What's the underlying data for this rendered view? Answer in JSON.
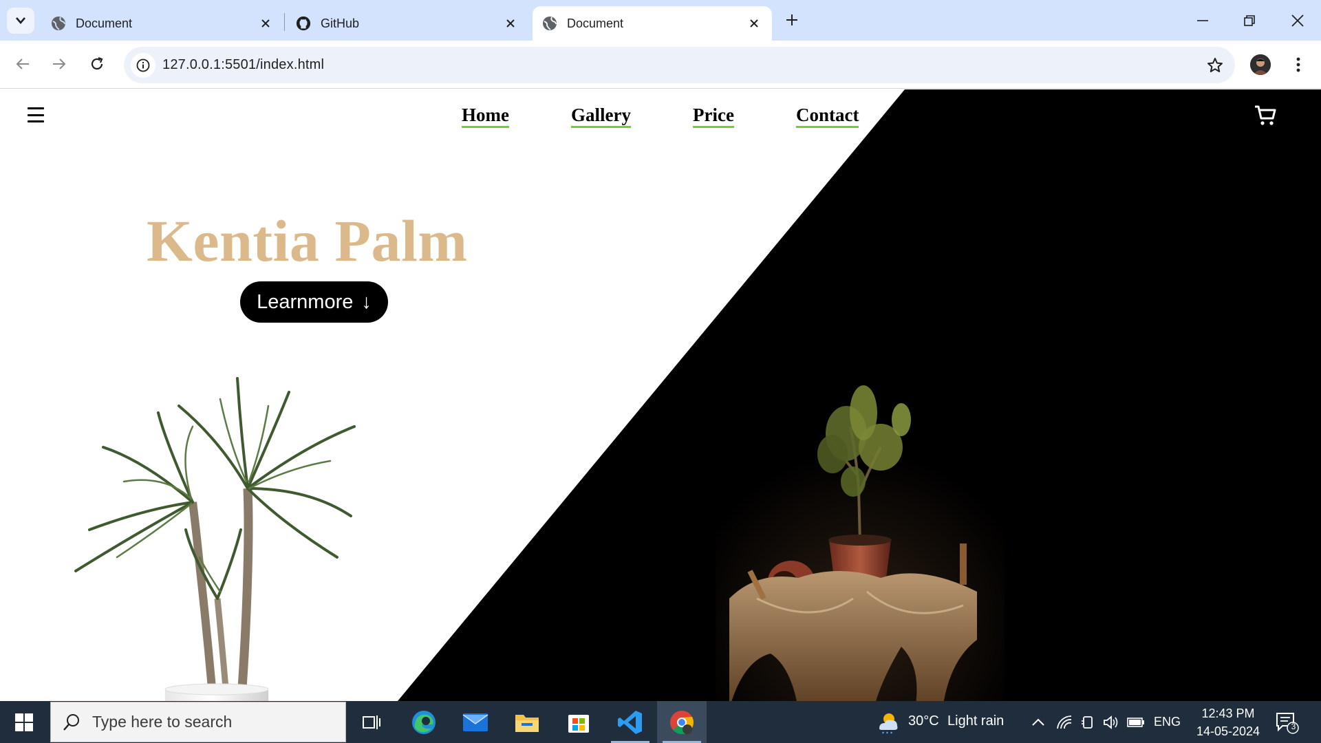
{
  "browser": {
    "tabs": [
      {
        "title": "Document",
        "icon": "globe-icon",
        "active": false
      },
      {
        "title": "GitHub",
        "icon": "github-icon",
        "active": false
      },
      {
        "title": "Document",
        "icon": "globe-icon",
        "active": true
      }
    ],
    "url": "127.0.0.1:5501/index.html"
  },
  "page": {
    "nav": {
      "home": "Home",
      "gallery": "Gallery",
      "price": "Price",
      "contact": "Contact"
    },
    "hero_title": "Kentia Palm",
    "cta_label": "Learnmore",
    "cta_icon": "↓",
    "colors": {
      "title": "#dcb98a",
      "nav_underline": "#6ed12c",
      "dark_panel": "#000000"
    }
  },
  "taskbar": {
    "search_placeholder": "Type here to search",
    "weather_temp": "30°C",
    "weather_desc": "Light rain",
    "language": "ENG",
    "time": "12:43 PM",
    "date": "14-05-2024",
    "notification_count": "3"
  }
}
